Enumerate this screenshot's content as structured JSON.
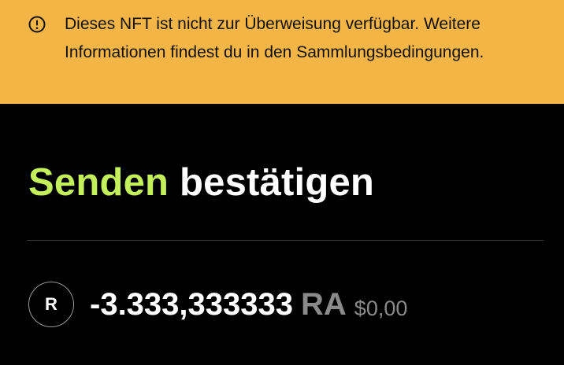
{
  "warning": {
    "icon": "alert-circle-icon",
    "message": "Dieses NFT ist nicht zur Überweisung verfügbar. Weitere Informationen findest du in den Sammlungsbedingungen.",
    "background_color": "#F4B547"
  },
  "title": {
    "accent": "Senden",
    "rest": "bestätigen",
    "accent_color": "#C3F05B"
  },
  "token": {
    "avatar_letter": "R",
    "amount": "-3.333,333333",
    "symbol": "RA",
    "fiat_value": "$0,00"
  }
}
